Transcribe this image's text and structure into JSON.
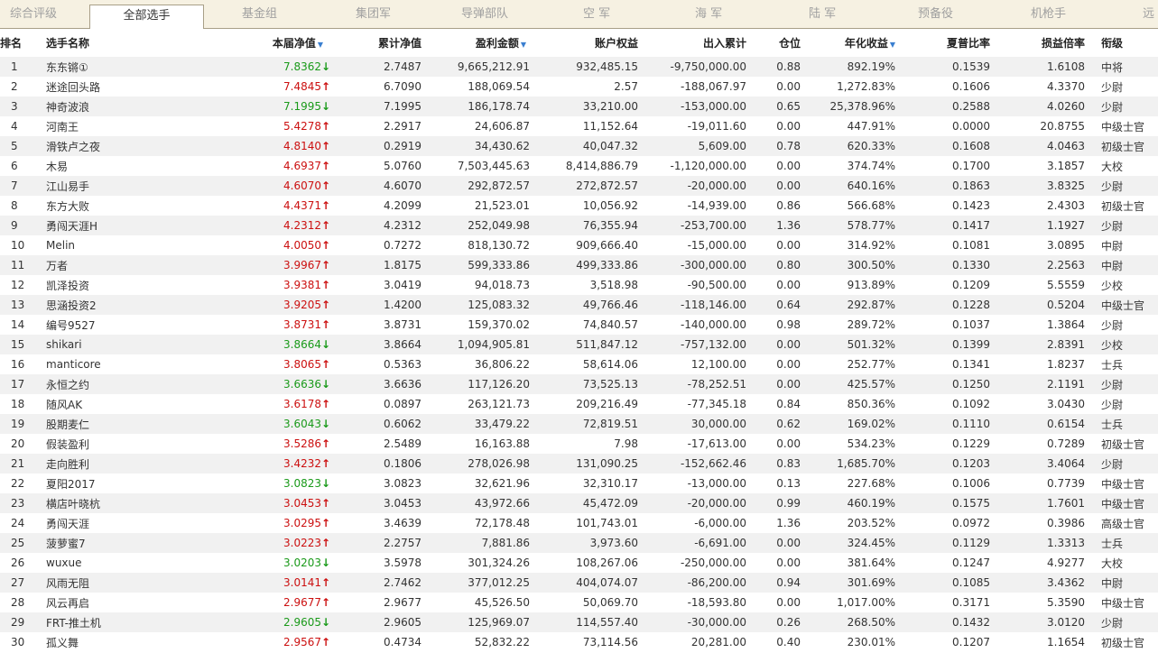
{
  "tabs": [
    "综合评级",
    "全部选手",
    "基金组",
    "集团军",
    "导弹部队",
    "空 军",
    "海 军",
    "陆 军",
    "预备役",
    "机枪手",
    "远"
  ],
  "headers": {
    "rank": "排名",
    "name": "选手名称",
    "nav": "本届净值",
    "cum_nav": "累计净值",
    "profit": "盈利金额",
    "equity": "账户权益",
    "inout": "出入累计",
    "position": "仓位",
    "annual": "年化收益",
    "sharpe": "夏普比率",
    "pl_ratio": "损益倍率",
    "rank_title": "衔级"
  },
  "sort_icon": "triangle-down",
  "colors": {
    "up": "#cc1010",
    "down": "#1a9a1a",
    "sort": "#3a7fd0",
    "tab_bg": "#f6f1e2"
  },
  "rows": [
    {
      "rank": "1",
      "name": "东东锵①",
      "nav": "7.8362",
      "dir": "down",
      "cum": "2.7487",
      "profit": "9,665,212.91",
      "equity": "932,485.15",
      "inout": "-9,750,000.00",
      "pos": "0.88",
      "annual": "892.19%",
      "sharpe": "0.1539",
      "pl": "1.6108",
      "title": "中将"
    },
    {
      "rank": "2",
      "name": "迷途回头路",
      "nav": "7.4845",
      "dir": "up",
      "cum": "6.7090",
      "profit": "188,069.54",
      "equity": "2.57",
      "inout": "-188,067.97",
      "pos": "0.00",
      "annual": "1,272.83%",
      "sharpe": "0.1606",
      "pl": "4.3370",
      "title": "少尉"
    },
    {
      "rank": "3",
      "name": "神奇波浪",
      "nav": "7.1995",
      "dir": "down",
      "cum": "7.1995",
      "profit": "186,178.74",
      "equity": "33,210.00",
      "inout": "-153,000.00",
      "pos": "0.65",
      "annual": "25,378.96%",
      "sharpe": "0.2588",
      "pl": "4.0260",
      "title": "少尉"
    },
    {
      "rank": "4",
      "name": "河南王",
      "nav": "5.4278",
      "dir": "up",
      "cum": "2.2917",
      "profit": "24,606.87",
      "equity": "11,152.64",
      "inout": "-19,011.60",
      "pos": "0.00",
      "annual": "447.91%",
      "sharpe": "0.0000",
      "pl": "20.8755",
      "title": "中级士官"
    },
    {
      "rank": "5",
      "name": "滑铁卢之夜",
      "nav": "4.8140",
      "dir": "up",
      "cum": "0.2919",
      "profit": "34,430.62",
      "equity": "40,047.32",
      "inout": "5,609.00",
      "pos": "0.78",
      "annual": "620.33%",
      "sharpe": "0.1608",
      "pl": "4.0463",
      "title": "初级士官"
    },
    {
      "rank": "6",
      "name": "木易",
      "nav": "4.6937",
      "dir": "up",
      "cum": "5.0760",
      "profit": "7,503,445.63",
      "equity": "8,414,886.79",
      "inout": "-1,120,000.00",
      "pos": "0.00",
      "annual": "374.74%",
      "sharpe": "0.1700",
      "pl": "3.1857",
      "title": "大校"
    },
    {
      "rank": "7",
      "name": "江山易手",
      "nav": "4.6070",
      "dir": "up",
      "cum": "4.6070",
      "profit": "292,872.57",
      "equity": "272,872.57",
      "inout": "-20,000.00",
      "pos": "0.00",
      "annual": "640.16%",
      "sharpe": "0.1863",
      "pl": "3.8325",
      "title": "少尉"
    },
    {
      "rank": "8",
      "name": "东方大败",
      "nav": "4.4371",
      "dir": "up",
      "cum": "4.2099",
      "profit": "21,523.01",
      "equity": "10,056.92",
      "inout": "-14,939.00",
      "pos": "0.86",
      "annual": "566.68%",
      "sharpe": "0.1423",
      "pl": "2.4303",
      "title": "初级士官"
    },
    {
      "rank": "9",
      "name": "勇闯天涯H",
      "nav": "4.2312",
      "dir": "up",
      "cum": "4.2312",
      "profit": "252,049.98",
      "equity": "76,355.94",
      "inout": "-253,700.00",
      "pos": "1.36",
      "annual": "578.77%",
      "sharpe": "0.1417",
      "pl": "1.1927",
      "title": "少尉"
    },
    {
      "rank": "10",
      "name": "Melin",
      "nav": "4.0050",
      "dir": "up",
      "cum": "0.7272",
      "profit": "818,130.72",
      "equity": "909,666.40",
      "inout": "-15,000.00",
      "pos": "0.00",
      "annual": "314.92%",
      "sharpe": "0.1081",
      "pl": "3.0895",
      "title": "中尉"
    },
    {
      "rank": "11",
      "name": "万者",
      "nav": "3.9967",
      "dir": "up",
      "cum": "1.8175",
      "profit": "599,333.86",
      "equity": "499,333.86",
      "inout": "-300,000.00",
      "pos": "0.80",
      "annual": "300.50%",
      "sharpe": "0.1330",
      "pl": "2.2563",
      "title": "中尉"
    },
    {
      "rank": "12",
      "name": "凯泽投资",
      "nav": "3.9381",
      "dir": "up",
      "cum": "3.0419",
      "profit": "94,018.73",
      "equity": "3,518.98",
      "inout": "-90,500.00",
      "pos": "0.00",
      "annual": "913.89%",
      "sharpe": "0.1209",
      "pl": "5.5559",
      "title": "少校"
    },
    {
      "rank": "13",
      "name": "思涵投资2",
      "nav": "3.9205",
      "dir": "up",
      "cum": "1.4200",
      "profit": "125,083.32",
      "equity": "49,766.46",
      "inout": "-118,146.00",
      "pos": "0.64",
      "annual": "292.87%",
      "sharpe": "0.1228",
      "pl": "0.5204",
      "title": "中级士官"
    },
    {
      "rank": "14",
      "name": "编号9527",
      "nav": "3.8731",
      "dir": "up",
      "cum": "3.8731",
      "profit": "159,370.02",
      "equity": "74,840.57",
      "inout": "-140,000.00",
      "pos": "0.98",
      "annual": "289.72%",
      "sharpe": "0.1037",
      "pl": "1.3864",
      "title": "少尉"
    },
    {
      "rank": "15",
      "name": "shikari",
      "nav": "3.8664",
      "dir": "down",
      "cum": "3.8664",
      "profit": "1,094,905.81",
      "equity": "511,847.12",
      "inout": "-757,132.00",
      "pos": "0.00",
      "annual": "501.32%",
      "sharpe": "0.1399",
      "pl": "2.8391",
      "title": "少校"
    },
    {
      "rank": "16",
      "name": "manticore",
      "nav": "3.8065",
      "dir": "up",
      "cum": "0.5363",
      "profit": "36,806.22",
      "equity": "58,614.06",
      "inout": "12,100.00",
      "pos": "0.00",
      "annual": "252.77%",
      "sharpe": "0.1341",
      "pl": "1.8237",
      "title": "士兵"
    },
    {
      "rank": "17",
      "name": "永恒之约",
      "nav": "3.6636",
      "dir": "down",
      "cum": "3.6636",
      "profit": "117,126.20",
      "equity": "73,525.13",
      "inout": "-78,252.51",
      "pos": "0.00",
      "annual": "425.57%",
      "sharpe": "0.1250",
      "pl": "2.1191",
      "title": "少尉"
    },
    {
      "rank": "18",
      "name": "随风AK",
      "nav": "3.6178",
      "dir": "up",
      "cum": "0.0897",
      "profit": "263,121.73",
      "equity": "209,216.49",
      "inout": "-77,345.18",
      "pos": "0.84",
      "annual": "850.36%",
      "sharpe": "0.1092",
      "pl": "3.0430",
      "title": "少尉"
    },
    {
      "rank": "19",
      "name": "股期麦仁",
      "nav": "3.6043",
      "dir": "down",
      "cum": "0.6062",
      "profit": "33,479.22",
      "equity": "72,819.51",
      "inout": "30,000.00",
      "pos": "0.62",
      "annual": "169.02%",
      "sharpe": "0.1110",
      "pl": "0.6154",
      "title": "士兵"
    },
    {
      "rank": "20",
      "name": "假装盈利",
      "nav": "3.5286",
      "dir": "up",
      "cum": "2.5489",
      "profit": "16,163.88",
      "equity": "7.98",
      "inout": "-17,613.00",
      "pos": "0.00",
      "annual": "534.23%",
      "sharpe": "0.1229",
      "pl": "0.7289",
      "title": "初级士官"
    },
    {
      "rank": "21",
      "name": "走向胜利",
      "nav": "3.4232",
      "dir": "up",
      "cum": "0.1806",
      "profit": "278,026.98",
      "equity": "131,090.25",
      "inout": "-152,662.46",
      "pos": "0.83",
      "annual": "1,685.70%",
      "sharpe": "0.1203",
      "pl": "3.4064",
      "title": "少尉"
    },
    {
      "rank": "22",
      "name": "夏阳2017",
      "nav": "3.0823",
      "dir": "down",
      "cum": "3.0823",
      "profit": "32,621.96",
      "equity": "32,310.17",
      "inout": "-13,000.00",
      "pos": "0.13",
      "annual": "227.68%",
      "sharpe": "0.1006",
      "pl": "0.7739",
      "title": "中级士官"
    },
    {
      "rank": "23",
      "name": "横店叶晓杭",
      "nav": "3.0453",
      "dir": "up",
      "cum": "3.0453",
      "profit": "43,972.66",
      "equity": "45,472.09",
      "inout": "-20,000.00",
      "pos": "0.99",
      "annual": "460.19%",
      "sharpe": "0.1575",
      "pl": "1.7601",
      "title": "中级士官"
    },
    {
      "rank": "24",
      "name": "勇闯天涯",
      "nav": "3.0295",
      "dir": "up",
      "cum": "3.4639",
      "profit": "72,178.48",
      "equity": "101,743.01",
      "inout": "-6,000.00",
      "pos": "1.36",
      "annual": "203.52%",
      "sharpe": "0.0972",
      "pl": "0.3986",
      "title": "高级士官"
    },
    {
      "rank": "25",
      "name": "菠萝蜜7",
      "nav": "3.0223",
      "dir": "up",
      "cum": "2.2757",
      "profit": "7,881.86",
      "equity": "3,973.60",
      "inout": "-6,691.00",
      "pos": "0.00",
      "annual": "324.45%",
      "sharpe": "0.1129",
      "pl": "1.3313",
      "title": "士兵"
    },
    {
      "rank": "26",
      "name": "wuxue",
      "nav": "3.0203",
      "dir": "down",
      "cum": "3.5978",
      "profit": "301,324.26",
      "equity": "108,267.06",
      "inout": "-250,000.00",
      "pos": "0.00",
      "annual": "381.64%",
      "sharpe": "0.1247",
      "pl": "4.9277",
      "title": "大校"
    },
    {
      "rank": "27",
      "name": "风雨无阻",
      "nav": "3.0141",
      "dir": "up",
      "cum": "2.7462",
      "profit": "377,012.25",
      "equity": "404,074.07",
      "inout": "-86,200.00",
      "pos": "0.94",
      "annual": "301.69%",
      "sharpe": "0.1085",
      "pl": "3.4362",
      "title": "中尉"
    },
    {
      "rank": "28",
      "name": "风云再启",
      "nav": "2.9677",
      "dir": "up",
      "cum": "2.9677",
      "profit": "45,526.50",
      "equity": "50,069.70",
      "inout": "-18,593.80",
      "pos": "0.00",
      "annual": "1,017.00%",
      "sharpe": "0.3171",
      "pl": "5.3590",
      "title": "中级士官"
    },
    {
      "rank": "29",
      "name": "FRT-推土机",
      "nav": "2.9605",
      "dir": "down",
      "cum": "2.9605",
      "profit": "125,969.07",
      "equity": "114,557.40",
      "inout": "-30,000.00",
      "pos": "0.26",
      "annual": "268.50%",
      "sharpe": "0.1432",
      "pl": "3.0120",
      "title": "少尉"
    },
    {
      "rank": "30",
      "name": "孤义舞",
      "nav": "2.9567",
      "dir": "up",
      "cum": "0.4734",
      "profit": "52,832.22",
      "equity": "73,114.56",
      "inout": "20,281.00",
      "pos": "0.40",
      "annual": "230.01%",
      "sharpe": "0.1207",
      "pl": "1.1654",
      "title": "初级士官"
    }
  ]
}
